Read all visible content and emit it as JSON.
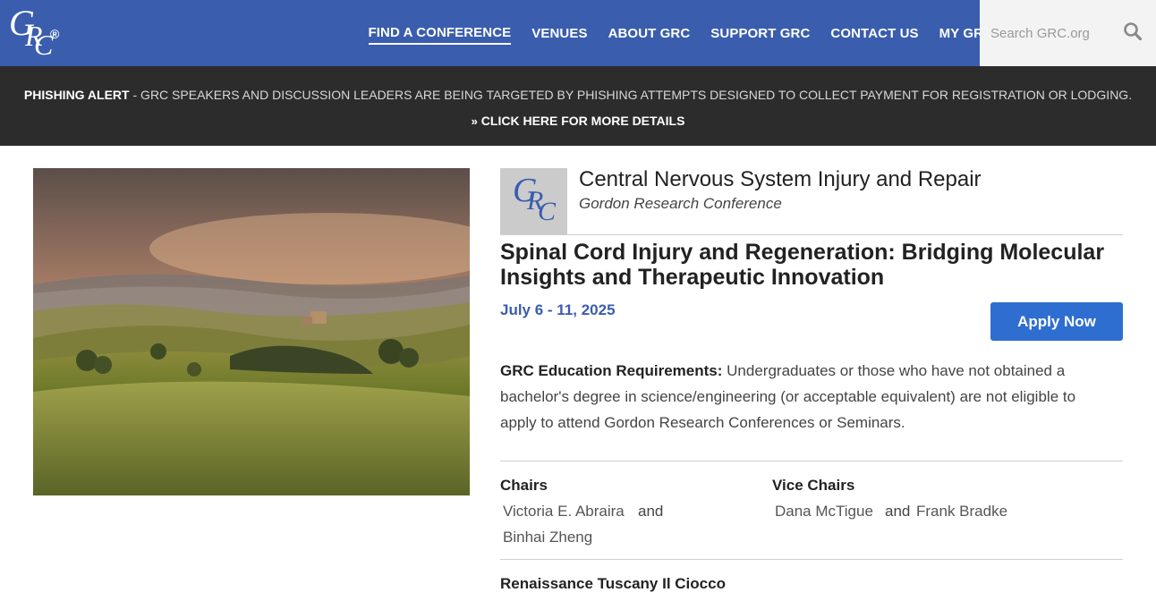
{
  "header": {
    "logo_letters": [
      "G",
      "R",
      "C"
    ],
    "logo_reg": "®",
    "nav": [
      {
        "label": "FIND A CONFERENCE",
        "active": true
      },
      {
        "label": "VENUES"
      },
      {
        "label": "ABOUT GRC"
      },
      {
        "label": "SUPPORT GRC"
      },
      {
        "label": "CONTACT US"
      },
      {
        "label": "MY GRC"
      }
    ],
    "search_placeholder": "Search GRC.org",
    "search_icon": "search-icon",
    "colors": {
      "brand_blue": "#3a5dae",
      "alert_bg": "#2c2c2c"
    }
  },
  "alert": {
    "title": "PHISHING ALERT",
    "message": " - GRC SPEAKERS AND DISCUSSION LEADERS ARE BEING TARGETED BY PHISHING ATTEMPTS DESIGNED TO COLLECT PAYMENT FOR REGISTRATION OR LODGING.",
    "link_icon": "double-chevron-right-icon",
    "link_label": "CLICK HERE FOR MORE DETAILS"
  },
  "conference": {
    "logo_letters": [
      "G",
      "R",
      "C"
    ],
    "name": "Central Nervous System Injury and Repair",
    "series": "Gordon Research Conference",
    "title": "Spinal Cord Injury and Regeneration: Bridging Molecular Insights and Therapeutic Innovation",
    "dates": "July 6 - 11, 2025",
    "apply_label": "Apply Now",
    "education_label": "GRC Education Requirements:",
    "education_text": " Undergraduates or those who have not obtained a bachelor's degree in science/engineering (or acceptable equivalent) are not eligible to apply to attend Gordon Research Conferences or Seminars.",
    "chairs_label": "Chairs",
    "chairs": [
      "Victoria E. Abraira",
      "Binhai Zheng"
    ],
    "vice_chairs_label": "Vice Chairs",
    "vice_chairs": [
      "Dana McTigue",
      "Frank Bradke"
    ],
    "and_word": "and",
    "venue": "Renaissance Tuscany Il Ciocco"
  }
}
